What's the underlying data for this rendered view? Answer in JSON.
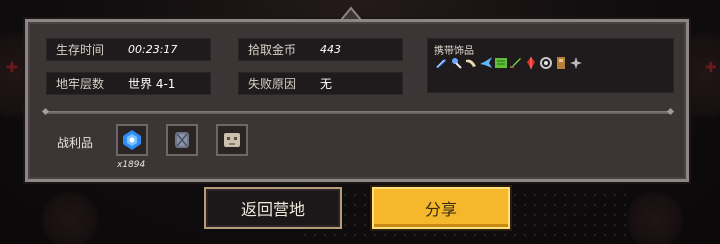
{
  "stats": {
    "survival_time": {
      "label": "生存时间",
      "value": "00:23:17"
    },
    "gold": {
      "label": "拾取金币",
      "value": "443"
    },
    "dungeon_level": {
      "label": "地牢层数",
      "value": "世界 4-1"
    },
    "fail_reason": {
      "label": "失败原因",
      "value": "无"
    }
  },
  "accessories": {
    "title": "携带饰品",
    "items": [
      {
        "icon": "blue-feather-icon",
        "color": "#4a8cff"
      },
      {
        "icon": "blue-charm-icon",
        "color": "#6aa8ff"
      },
      {
        "icon": "bone-horn-icon",
        "color": "#e8d9b0"
      },
      {
        "icon": "blue-bird-icon",
        "color": "#5fb7ff"
      },
      {
        "icon": "green-scroll-icon",
        "color": "#5fbf3a"
      },
      {
        "icon": "green-blade-icon",
        "color": "#6ad04a"
      },
      {
        "icon": "red-crystal-icon",
        "color": "#e0302a"
      },
      {
        "icon": "lantern-icon",
        "color": "#c8c8c8"
      },
      {
        "icon": "brown-book-icon",
        "color": "#b7803a"
      },
      {
        "icon": "gray-star-icon",
        "color": "#b9b9b9"
      }
    ]
  },
  "loot": {
    "label": "战利品",
    "items": [
      {
        "icon": "blue-gem-icon",
        "color": "#2e8df0",
        "count": "x1894"
      },
      {
        "icon": "stone-golem-icon",
        "color": "#8a93a8",
        "count": ""
      },
      {
        "icon": "pale-skull-icon",
        "color": "#cdbfae",
        "count": ""
      }
    ]
  },
  "buttons": {
    "return_camp": "返回营地",
    "share": "分享"
  }
}
